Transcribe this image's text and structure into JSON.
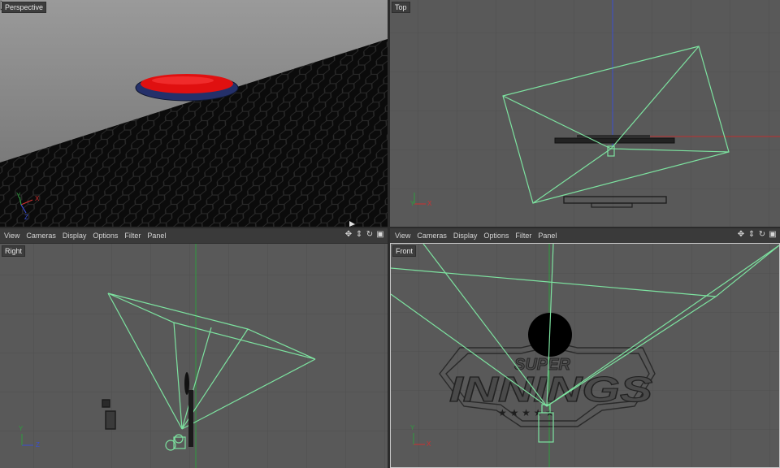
{
  "viewports": {
    "perspective": {
      "label": "Perspective"
    },
    "top": {
      "label": "Top"
    },
    "right": {
      "label": "Right"
    },
    "front": {
      "label": "Front"
    }
  },
  "menu": {
    "items": [
      "View",
      "Cameras",
      "Display",
      "Options",
      "Filter",
      "Panel"
    ]
  },
  "nav_icons": [
    "move-icon",
    "zoom-icon",
    "rotate-icon",
    "maximize-icon"
  ],
  "axes": {
    "x": "X",
    "y": "Y",
    "z": "Z"
  },
  "logo": {
    "line1": "SUPER",
    "line2": "INNINGS"
  },
  "colors": {
    "camera_frustum": "#7de3a0",
    "viewport_bg": "#595959",
    "grid": "#4e4e4e",
    "axis_x": "#d03030",
    "axis_y": "#2f9b3f",
    "axis_z": "#3a4fd0",
    "disc_red": "#e01010",
    "disc_blue": "#24306a"
  }
}
